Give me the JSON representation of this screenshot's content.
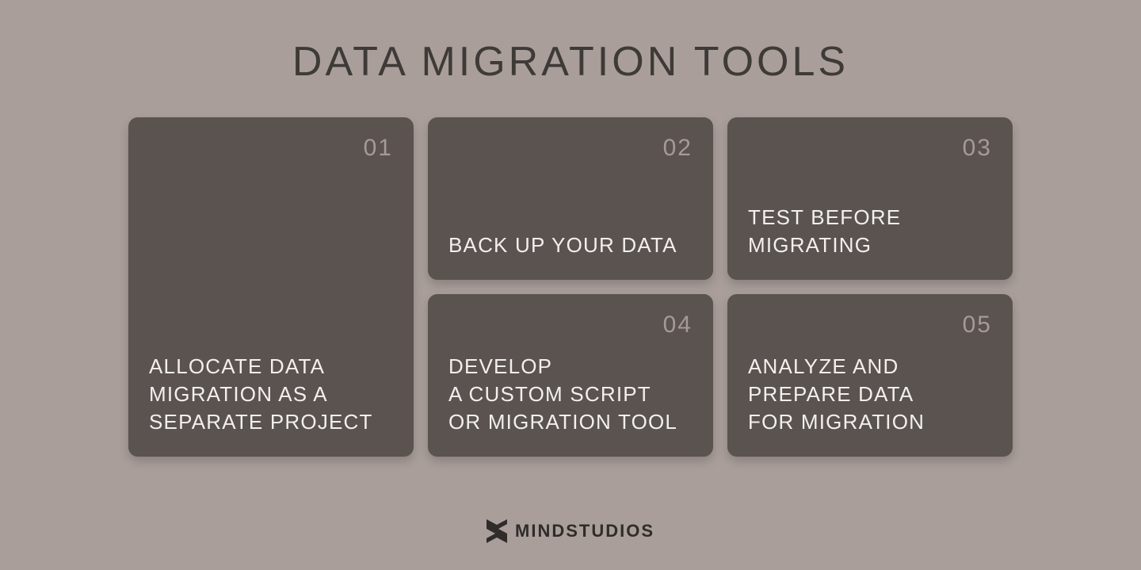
{
  "title": "DATA MIGRATION TOOLS",
  "cards": [
    {
      "num": "01",
      "text": "ALLOCATE DATA\nMIGRATION AS A\nSEPARATE PROJECT"
    },
    {
      "num": "02",
      "text": "BACK UP YOUR DATA"
    },
    {
      "num": "03",
      "text": "TEST BEFORE\nMIGRATING"
    },
    {
      "num": "04",
      "text": "DEVELOP\nA CUSTOM SCRIPT\nOR MIGRATION TOOL"
    },
    {
      "num": "05",
      "text": "ANALYZE AND\nPREPARE DATA\nFOR MIGRATION"
    }
  ],
  "footer": {
    "brand": "MINDSTUDIOS"
  }
}
